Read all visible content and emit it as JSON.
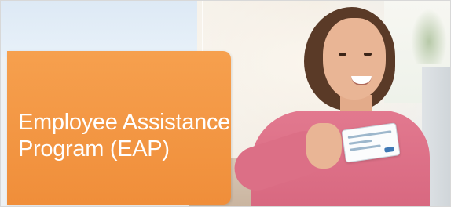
{
  "banner": {
    "title_line_1": "Employee Assistance",
    "title_line_2": "Program (EAP)",
    "panel_color": "#f6a04e",
    "photo": {
      "subject": "smiling-woman-holding-card-icon"
    }
  }
}
